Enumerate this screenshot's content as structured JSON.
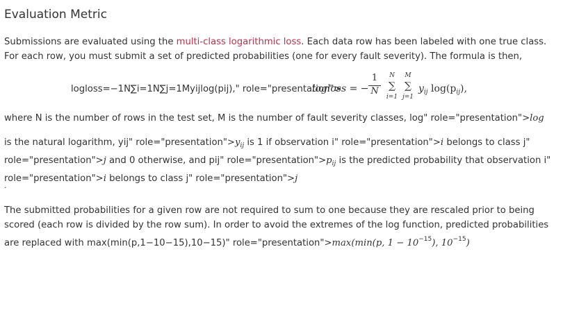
{
  "title": "Evaluation Metric",
  "intro": {
    "before": "Submissions are evaluated using the ",
    "link": "multi-class logarithmic loss",
    "after": ". Each data row has been labeled with one true class. For each row, you must submit a set of predicted probabilities (one for every fault severity). The formula is then,"
  },
  "formula": {
    "source": "logloss=−1N∑i=1N∑j=1Myijlog(pij),\" role=\"presentation\">",
    "rendered_lhs": "logloss = −",
    "frac_num": "1",
    "frac_den": "N",
    "sum1_top": "N",
    "sum1_bot": "i=1",
    "sum2_top": "M",
    "sum2_bot": "j=1",
    "rendered_rhs": "y",
    "rhs_sub": "ij",
    "rhs_log": " log(p",
    "rhs_log_sub": "ij",
    "rhs_end": "),"
  },
  "where_line": {
    "text": "where N is the number of rows in the test set, M is the number of fault severity classes,  log\" role=\"presentation\">",
    "math": "log"
  },
  "definitions": {
    "t1": "is the natural logarithm, yij\" role=\"presentation\">",
    "m1": "y",
    "m1_sub": "ij",
    "t2": " is 1 if observation i\" role=\"presentation\">",
    "m2": "i",
    "t3": " belongs to class j\" role=\"presentation\">",
    "m3": "j",
    "t4": " and 0 otherwise, and pij\" role=\"presentation\">",
    "m4": "p",
    "m4_sub": "ij",
    "t5": " is the predicted probability that observation i\" role=\"presentation\">",
    "m5": "i",
    "t6": " belongs to class j\" role=\"presentation\">",
    "m6": "j"
  },
  "period": ".",
  "closing": {
    "text": "The submitted probabilities for a given row are not required to sum to one because they are rescaled prior to being scored (each row is divided by the row sum). In order to avoid the extremes of the log function, predicted probabilities are replaced with max(min(p,1−10−15),10−15)\" role=\"presentation\">",
    "m_a": "max(min(p, ",
    "m_b": "1 − 10",
    "m_b_sup": "−15",
    "m_c": "), 10",
    "m_c_sup": "−15",
    "m_d": ")"
  }
}
